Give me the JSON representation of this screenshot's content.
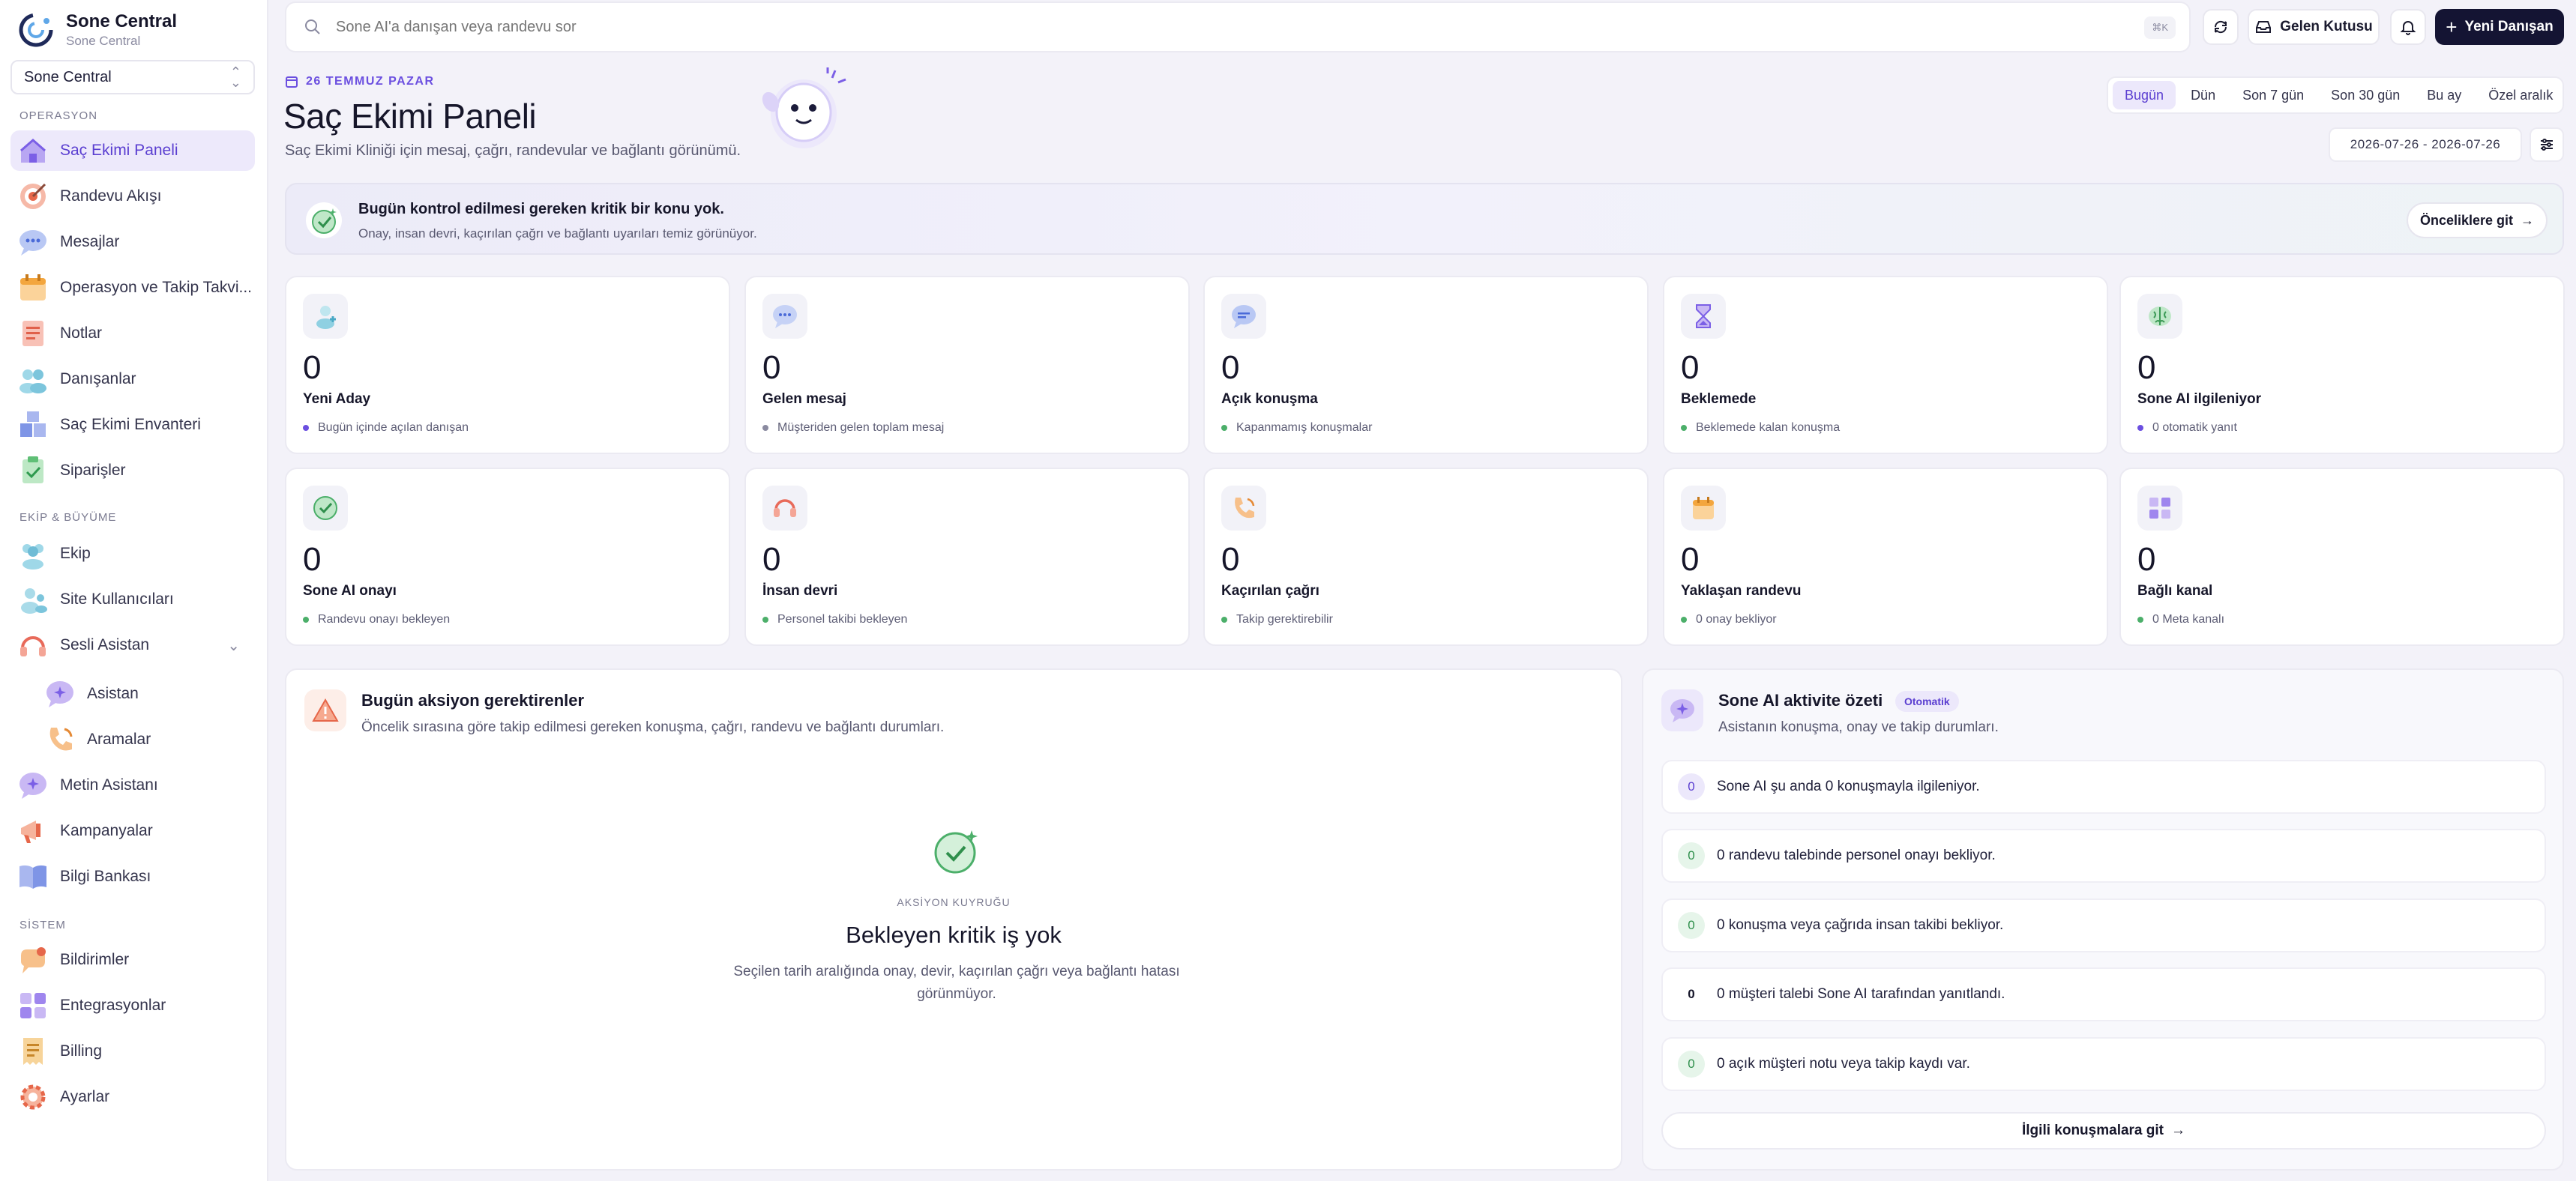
{
  "brand": {
    "title": "Sone Central",
    "subtitle": "Sone Central"
  },
  "workspace": {
    "selected": "Sone Central"
  },
  "sidebar": {
    "sections": {
      "operasyon": "OPERASYON",
      "ekip": "EKİP & BÜYÜME",
      "sistem": "SİSTEM"
    },
    "items": [
      {
        "label": "Saç Ekimi Paneli"
      },
      {
        "label": "Randevu Akışı"
      },
      {
        "label": "Mesajlar"
      },
      {
        "label": "Operasyon ve Takip Takvi..."
      },
      {
        "label": "Notlar"
      },
      {
        "label": "Danışanlar"
      },
      {
        "label": "Saç Ekimi Envanteri"
      },
      {
        "label": "Siparişler"
      },
      {
        "label": "Ekip"
      },
      {
        "label": "Site Kullanıcıları"
      },
      {
        "label": "Sesli Asistan"
      },
      {
        "label": "Asistan"
      },
      {
        "label": "Aramalar"
      },
      {
        "label": "Metin Asistanı"
      },
      {
        "label": "Kampanyalar"
      },
      {
        "label": "Bilgi Bankası"
      },
      {
        "label": "Bildirimler"
      },
      {
        "label": "Entegrasyonlar"
      },
      {
        "label": "Billing"
      },
      {
        "label": "Ayarlar"
      }
    ]
  },
  "search": {
    "placeholder": "Sone AI'a danışan veya randevu sor",
    "shortcut": "⌘K"
  },
  "topbar": {
    "inbox_label": "Gelen Kutusu",
    "new_client_label": "Yeni Danışan"
  },
  "header": {
    "date": "26 TEMMUZ PAZAR",
    "title": "Saç Ekimi Paneli",
    "subtitle": "Saç Ekimi Kliniği için mesaj, çağrı, randevular ve bağlantı görünümü."
  },
  "range": {
    "tabs": [
      "Bugün",
      "Dün",
      "Son 7 gün",
      "Son 30 gün",
      "Bu ay",
      "Özel aralık"
    ],
    "active": "Bugün",
    "date_range": "2026-07-26 - 2026-07-26"
  },
  "banner": {
    "title": "Bugün kontrol edilmesi gereken kritik bir konu yok.",
    "subtitle": "Onay, insan devri, kaçırılan çağrı ve bağlantı uyarıları temiz görünüyor.",
    "button": "Önceliklere git"
  },
  "cards": [
    {
      "value": "0",
      "label": "Yeni Aday",
      "note": "Bugün içinde açılan danışan",
      "dot": "#6b4fe0",
      "icon": "users-icon"
    },
    {
      "value": "0",
      "label": "Gelen mesaj",
      "note": "Müşteriden gelen toplam mesaj",
      "dot": "#8a8aa0",
      "icon": "chat-icon"
    },
    {
      "value": "0",
      "label": "Açık konuşma",
      "note": "Kapanmamış konuşmalar",
      "dot": "#4caf6a",
      "icon": "chat-bubble-icon"
    },
    {
      "value": "0",
      "label": "Beklemede",
      "note": "Beklemede kalan konuşma",
      "dot": "#4caf6a",
      "icon": "hourglass-icon"
    },
    {
      "value": "0",
      "label": "Sone AI ilgileniyor",
      "note": "0 otomatik yanıt",
      "dot": "#6b4fe0",
      "icon": "brain-icon"
    },
    {
      "value": "0",
      "label": "Sone AI onayı",
      "note": "Randevu onayı bekleyen",
      "dot": "#4caf6a",
      "icon": "check-badge-icon"
    },
    {
      "value": "0",
      "label": "İnsan devri",
      "note": "Personel takibi bekleyen",
      "dot": "#4caf6a",
      "icon": "headset-icon"
    },
    {
      "value": "0",
      "label": "Kaçırılan çağrı",
      "note": "Takip gerektirebilir",
      "dot": "#4caf6a",
      "icon": "phone-icon"
    },
    {
      "value": "0",
      "label": "Yaklaşan randevu",
      "note": "0 onay bekliyor",
      "dot": "#4caf6a",
      "icon": "calendar-icon"
    },
    {
      "value": "0",
      "label": "Bağlı kanal",
      "note": "0 Meta kanalı",
      "dot": "#4caf6a",
      "icon": "grid-icon"
    }
  ],
  "actions": {
    "title": "Bugün aksiyon gerektirenler",
    "subtitle": "Öncelik sırasına göre takip edilmesi gereken konuşma, çağrı, randevu ve bağlantı durumları.",
    "empty_kicker": "AKSİYON KUYRUĞU",
    "empty_title": "Bekleyen kritik iş yok",
    "empty_text": "Seçilen tarih aralığında onay, devir, kaçırılan çağrı veya bağlantı hatası görünmüyor."
  },
  "ai_summary": {
    "title": "Sone AI aktivite özeti",
    "badge": "Otomatik",
    "subtitle": "Asistanın konuşma, onay ve takip durumları.",
    "rows": [
      {
        "num": "0",
        "text": "Sone AI şu anda 0 konuşmayla ilgileniyor.",
        "bg": "#ece8fb",
        "fg": "#5b3fd1"
      },
      {
        "num": "0",
        "text": "0 randevu talebinde personel onayı bekliyor.",
        "bg": "#e6f5ea",
        "fg": "#2f8f4c"
      },
      {
        "num": "0",
        "text": "0 konuşma veya çağrıda insan takibi bekliyor.",
        "bg": "#e6f5ea",
        "fg": "#2f8f4c"
      },
      {
        "num": "0",
        "text": "0 müşteri talebi Sone AI tarafından yanıtlandı.",
        "bg": "#ffffff",
        "fg": "#16162a"
      },
      {
        "num": "0",
        "text": "0 açık müşteri notu veya takip kaydı var.",
        "bg": "#e6f5ea",
        "fg": "#2f8f4c"
      }
    ],
    "footer": "İlgili konuşmalara git"
  }
}
